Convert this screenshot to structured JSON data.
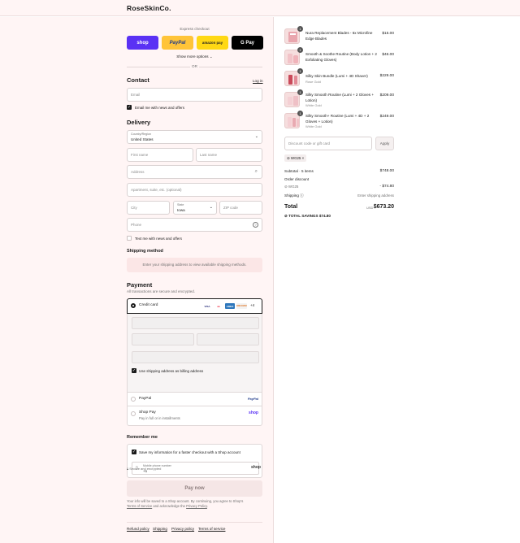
{
  "brand": {
    "name": "RoseSkinCo."
  },
  "express": {
    "label": "Express checkout",
    "shop_label": "shop",
    "paypal_label": "PayPal",
    "amazon_label": "amazon pay",
    "gpay_label": "G Pay",
    "more_label": "Show more options",
    "or_label": "OR"
  },
  "contact": {
    "title": "Contact",
    "login_label": "Log in",
    "email_placeholder": "Email",
    "email_news_label": "Email me with news and offers"
  },
  "delivery": {
    "title": "Delivery",
    "country_label": "Country/Region",
    "country_value": "United States",
    "first_name_placeholder": "First name",
    "last_name_placeholder": "Last name",
    "address_placeholder": "Address",
    "apartment_placeholder": "Apartment, suite, etc. (optional)",
    "city_placeholder": "City",
    "state_label": "State",
    "state_value": "Iowa",
    "zip_placeholder": "ZIP code",
    "phone_placeholder": "Phone",
    "text_news_label": "Text me with news and offers"
  },
  "shipping_method": {
    "title": "Shipping method",
    "note": "Enter your shipping address to view available shipping methods."
  },
  "payment": {
    "title": "Payment",
    "subtitle": "All transactions are secure and encrypted.",
    "credit_card_label": "Credit card",
    "card_brands": [
      "VISA",
      "MC",
      "AMEX",
      "DISCOVER"
    ],
    "more_cards": "+4",
    "billing_label": "Use shipping address as billing address",
    "paypal_label": "PayPal",
    "paypal_logo": "PayPal",
    "shoppay_label": "Shop Pay",
    "shoppay_sub": "Pay in full or in installments",
    "shoppay_logo": "shop"
  },
  "remember": {
    "title": "Remember me",
    "save_label": "Save my information for a faster checkout with a Shop account",
    "mobile_label": "Mobile phone number",
    "mobile_value": "+1",
    "secure_label": "Secure and encrypted",
    "shop_logo": "shop"
  },
  "pay_now": {
    "label": "Pay now",
    "terms_line1": "Your info will be saved to a Shop account. By continuing, you agree to Shop's",
    "terms_link1": "Terms of Service",
    "terms_mid": "and acknowledge the",
    "terms_link2": "Privacy Policy",
    "terms_end": "."
  },
  "footer": {
    "links": [
      "Refund policy",
      "Shipping",
      "Privacy policy",
      "Terms of service"
    ]
  },
  "cart": {
    "items": [
      {
        "qty": "1",
        "title_l1": "Nura Replacement Blades - 6x Microfine",
        "title_l2": "Edge Blades",
        "sub": "",
        "price": "$15.00"
      },
      {
        "qty": "1",
        "title_l1": "Smooth & Soothe Routine (Body Lotion + 2",
        "title_l2": "Exfoliating Gloves)",
        "sub": "",
        "price": "$46.00"
      },
      {
        "qty": "1",
        "title_l1": "Silky Skin Bundle (Lumi + 4D Shaver)",
        "title_l2": "",
        "sub": "Rose Gold",
        "price": "$229.00"
      },
      {
        "qty": "1",
        "title_l1": "Silky Smooth Routine (Lumi + 2 Gloves +",
        "title_l2": "Lotion)",
        "sub": "White Gold",
        "price": "$209.00"
      },
      {
        "qty": "1",
        "title_l1": "Silky Smooth+ Routine (Lumi + 4D + 2",
        "title_l2": "Gloves + Lotion)",
        "sub": "White Gold",
        "price": "$249.00"
      }
    ],
    "discount_placeholder": "Discount code or gift card",
    "apply_label": "Apply",
    "code_tag": "WG25",
    "subtotal_label": "Subtotal · 5 items",
    "subtotal_value": "$748.00",
    "order_discount_label": "Order discount",
    "discount_code": "WG25",
    "discount_value": "- $74.80",
    "shipping_label": "Shipping",
    "shipping_value": "Enter shipping address",
    "total_label": "Total",
    "total_currency": "USD",
    "total_value": "$673.20",
    "savings_label": "TOTAL SAVINGS",
    "savings_value": "$74.80"
  },
  "colors": {
    "left_bg": "#fff5f5",
    "shop_purple": "#5a31f4",
    "paypal_yellow": "#ffc439",
    "amazon_yellow": "#ffd814",
    "pay_button_bg": "#f5e6e6"
  }
}
